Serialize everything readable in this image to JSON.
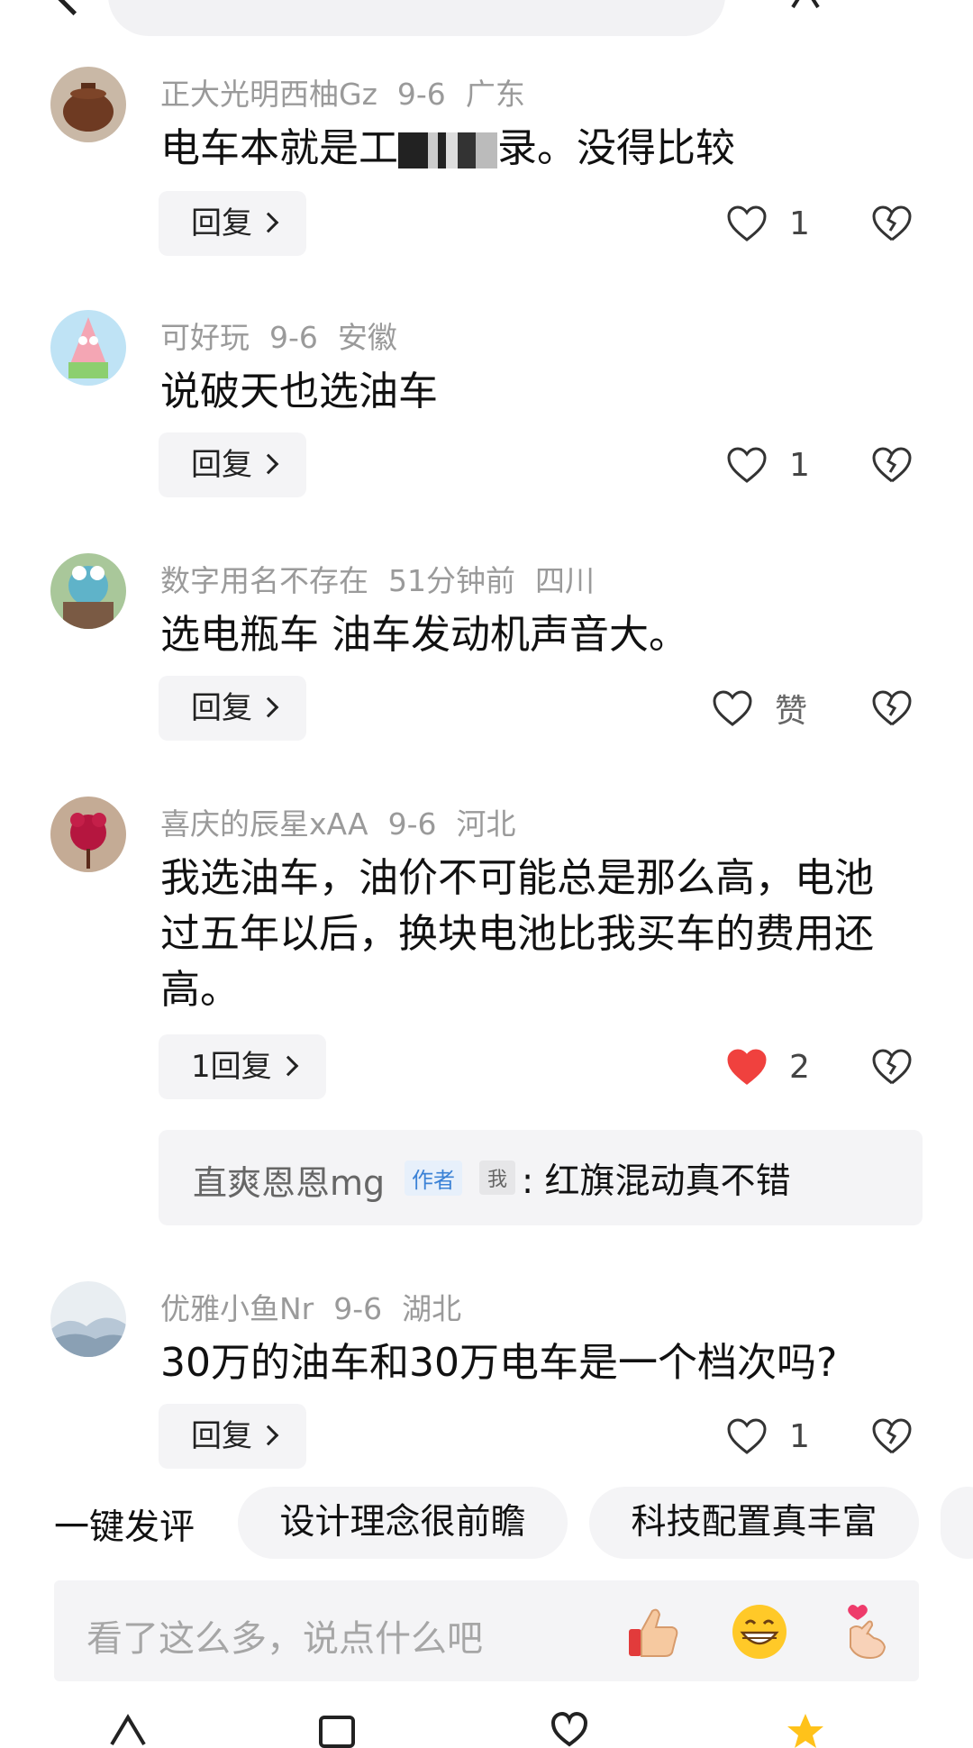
{
  "top": {
    "back_icon": "back-arrow-icon",
    "share_icon": "share-icon"
  },
  "comments": [
    {
      "user": "正大光明西柚Gz",
      "date": "9-6",
      "region": "广东",
      "text_before": "电车本就是工",
      "text_after": "录。没得比较",
      "reply_label": "回复",
      "likes": "1",
      "liked": false
    },
    {
      "user": "可好玩",
      "date": "9-6",
      "region": "安徽",
      "text": "说破天也选油车",
      "reply_label": "回复",
      "likes": "1",
      "liked": false
    },
    {
      "user": "数字用名不存在",
      "date": "51分钟前",
      "region": "四川",
      "text": "选电瓶车 油车发动机声音大。",
      "reply_label": "回复",
      "likes": "赞",
      "liked": false
    },
    {
      "user": "喜庆的辰星xAA",
      "date": "9-6",
      "region": "河北",
      "text": "我选油车，油价不可能总是那么高，电池过五年以后，换块电池比我买车的费用还高。",
      "reply_label": "1回复",
      "likes": "2",
      "liked": true,
      "sub_reply": {
        "name": "直爽恩恩mg",
        "author_badge": "作者",
        "me_badge": "我",
        "text": ": 红旗混动真不错"
      }
    },
    {
      "user": "优雅小鱼Nr",
      "date": "9-6",
      "region": "湖北",
      "text": "30万的油车和30万电车是一个档次吗?",
      "reply_label": "回复",
      "likes": "1",
      "liked": false
    }
  ],
  "quick": {
    "label": "一键发评",
    "chips": [
      "设计理念很前瞻",
      "科技配置真丰富"
    ]
  },
  "input": {
    "placeholder": "看了这么多，说点什么吧",
    "emojis": [
      "thumbs-up-emoji",
      "grin-emoji",
      "finger-heart-emoji"
    ]
  },
  "colors": {
    "liked_heart": "#f0413e",
    "meta_gray": "#9a9a9a",
    "badge_blue": "#3b82d6"
  }
}
